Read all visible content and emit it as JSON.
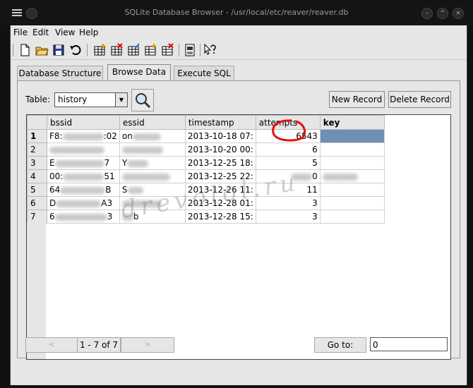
{
  "window": {
    "title": "SQLite Database Browser - /usr/local/etc/reaver/reaver.db"
  },
  "menu": [
    "File",
    "Edit",
    "View",
    "Help"
  ],
  "tabs": [
    {
      "label": "Database Structure",
      "active": false
    },
    {
      "label": "Browse Data",
      "active": true
    },
    {
      "label": "Execute SQL",
      "active": false
    }
  ],
  "browse": {
    "table_label": "Table:",
    "table_value": "history",
    "new_record": "New Record",
    "delete_record": "Delete Record",
    "columns": [
      "bssid",
      "essid",
      "timestamp",
      "attempts",
      "key"
    ],
    "rows": [
      {
        "num": "1",
        "bssid_a": "F8:",
        "bssid_b": ":02",
        "essid": "on",
        "timestamp": "2013-10-18 07:",
        "attempts": "6543",
        "key": ""
      },
      {
        "num": "2",
        "bssid_a": "",
        "bssid_b": "",
        "essid": "",
        "timestamp": "2013-10-20 00:",
        "attempts": "6",
        "key": ""
      },
      {
        "num": "3",
        "bssid_a": "E",
        "bssid_b": "7",
        "essid": "Y",
        "timestamp": "2013-12-25 18:",
        "attempts": "5",
        "key": ""
      },
      {
        "num": "4",
        "bssid_a": "00:",
        "bssid_b": "51",
        "essid": "",
        "timestamp": "2013-12-25 22:",
        "attempts": "0",
        "key": ""
      },
      {
        "num": "5",
        "bssid_a": "64",
        "bssid_b": "B",
        "essid": "S",
        "timestamp": "2013-12-26 11:",
        "attempts": "11",
        "key": ""
      },
      {
        "num": "6",
        "bssid_a": "D",
        "bssid_b": "A3",
        "essid": "",
        "timestamp": "2013-12-28 01:",
        "attempts": "3",
        "key": ""
      },
      {
        "num": "7",
        "bssid_a": "6",
        "bssid_b": "3",
        "essid": "b",
        "timestamp": "2013-12-28 15:",
        "attempts": "3",
        "key": ""
      }
    ],
    "record_label": "1 - 7 of 7",
    "prev_label": "<",
    "next_label": ">",
    "goto_label": "Go to:",
    "goto_value": "0"
  },
  "watermark": "drevolol.ru",
  "colors": {
    "selection": "#6f8fb5",
    "annotation": "#e01010"
  }
}
